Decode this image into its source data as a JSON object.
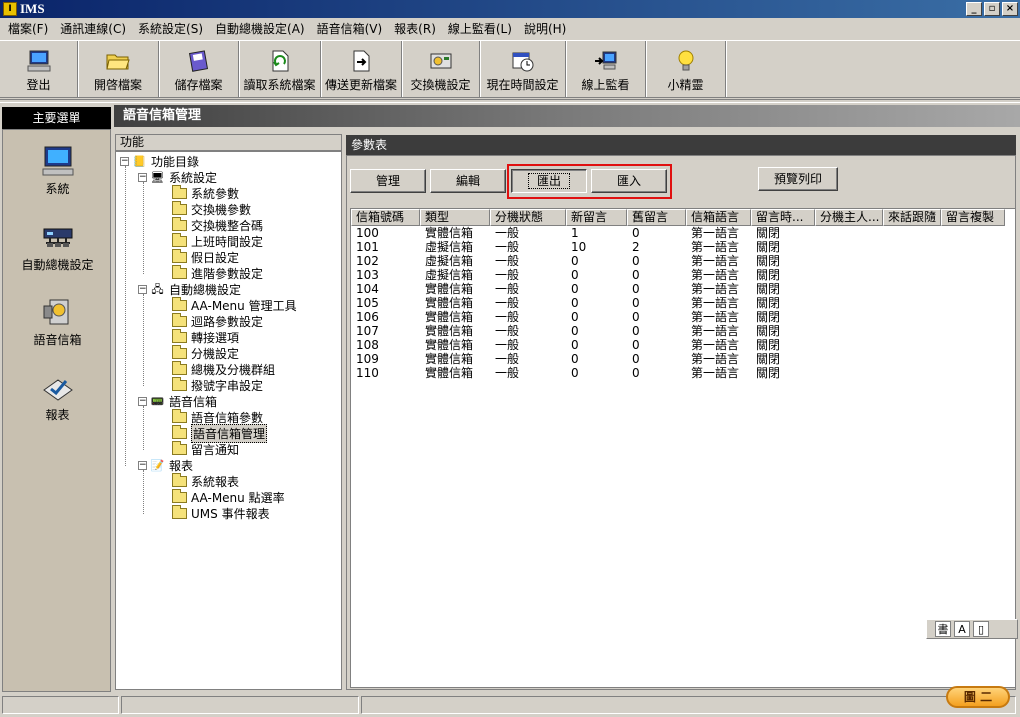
{
  "window": {
    "title": "IMS",
    "min_label": "_",
    "max_label": "▫",
    "close_label": "×"
  },
  "menu": [
    "檔案(F)",
    "通訊連線(C)",
    "系統設定(S)",
    "自動總機設定(A)",
    "語音信箱(V)",
    "報表(R)",
    "線上監看(L)",
    "說明(H)"
  ],
  "toolbar": [
    {
      "label": "登出",
      "icon": "computer-icon"
    },
    {
      "label": "開啓檔案",
      "icon": "open-folder-icon"
    },
    {
      "label": "儲存檔案",
      "icon": "save-icon"
    },
    {
      "label": "讀取系統檔案",
      "icon": "read-file-icon"
    },
    {
      "label": "傳送更新檔案",
      "icon": "send-file-icon"
    },
    {
      "label": "交換機設定",
      "icon": "switch-icon"
    },
    {
      "label": "現在時間設定",
      "icon": "calendar-clock-icon"
    },
    {
      "label": "線上監看",
      "icon": "monitor-icon"
    },
    {
      "label": "小精靈",
      "icon": "lightbulb-icon"
    }
  ],
  "nav": {
    "header": "主要選單",
    "items": [
      {
        "label": "系統",
        "icon": "computer-icon"
      },
      {
        "label": "自動總機設定",
        "icon": "switch-icon"
      },
      {
        "label": "語音信箱",
        "icon": "voicemail-icon"
      },
      {
        "label": "報表",
        "icon": "report-icon"
      }
    ]
  },
  "page_title": "語音信箱管理",
  "tree": {
    "header": "功能",
    "root": "功能目錄",
    "groups": [
      {
        "label": "系統設定",
        "children": [
          "系統參數",
          "交換機參數",
          "交換機整合碼",
          "上班時間設定",
          "假日設定",
          "進階參數設定"
        ]
      },
      {
        "label": "自動總機設定",
        "children": [
          "AA-Menu 管理工具",
          "迴路參數設定",
          "轉接選項",
          "分機設定",
          "總機及分機群組",
          "撥號字串設定"
        ]
      },
      {
        "label": "語音信箱",
        "children": [
          "語音信箱參數",
          "語音信箱管理",
          "留言通知"
        ]
      },
      {
        "label": "報表",
        "children": [
          "系統報表",
          "AA-Menu 點選率",
          "UMS 事件報表"
        ]
      }
    ],
    "selected": "語音信箱管理"
  },
  "content": {
    "header": "參數表",
    "buttons": {
      "manage": "管理",
      "edit": "編輯",
      "export": "匯出",
      "import": "匯入",
      "print_preview": "預覽列印"
    },
    "columns": [
      "信箱號碼",
      "類型",
      "分機狀態",
      "新留言",
      "舊留言",
      "信箱語言",
      "留言時...",
      "分機主人...",
      "來話跟隨",
      "留言複製"
    ],
    "rows": [
      [
        "100",
        "實體信箱",
        "一般",
        "1",
        "0",
        "第一語言",
        "關閉"
      ],
      [
        "101",
        "虛擬信箱",
        "一般",
        "10",
        "2",
        "第一語言",
        "關閉"
      ],
      [
        "102",
        "虛擬信箱",
        "一般",
        "0",
        "0",
        "第一語言",
        "關閉"
      ],
      [
        "103",
        "虛擬信箱",
        "一般",
        "0",
        "0",
        "第一語言",
        "關閉"
      ],
      [
        "104",
        "實體信箱",
        "一般",
        "0",
        "0",
        "第一語言",
        "關閉"
      ],
      [
        "105",
        "實體信箱",
        "一般",
        "0",
        "0",
        "第一語言",
        "關閉"
      ],
      [
        "106",
        "實體信箱",
        "一般",
        "0",
        "0",
        "第一語言",
        "關閉"
      ],
      [
        "107",
        "實體信箱",
        "一般",
        "0",
        "0",
        "第一語言",
        "關閉"
      ],
      [
        "108",
        "實體信箱",
        "一般",
        "0",
        "0",
        "第一語言",
        "關閉"
      ],
      [
        "109",
        "實體信箱",
        "一般",
        "0",
        "0",
        "第一語言",
        "關閉"
      ],
      [
        "110",
        "實體信箱",
        "一般",
        "0",
        "0",
        "第一語言",
        "關閉"
      ]
    ]
  },
  "langbar": [
    "書",
    "A",
    "▯"
  ],
  "status": {
    "ime_pill": "圖 二"
  },
  "colors": {
    "highlight": "#e01010",
    "header_dark": "#3c3c3c"
  }
}
